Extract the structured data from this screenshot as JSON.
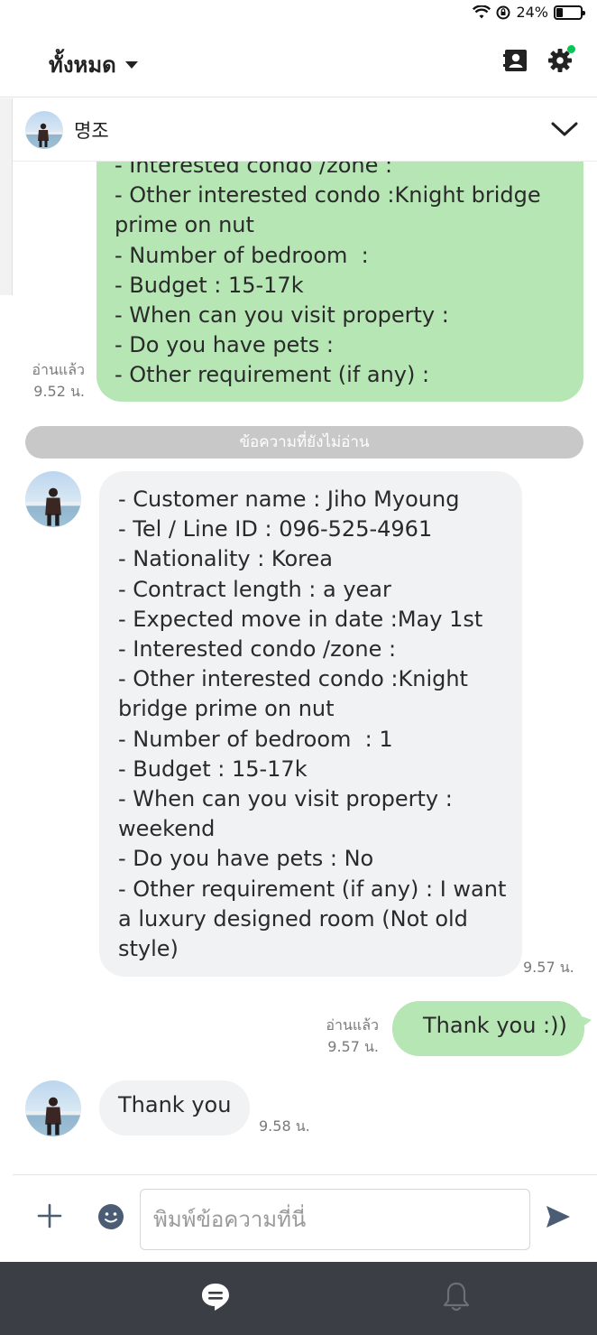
{
  "status_bar": {
    "battery_percent": "24%",
    "battery_level": 0.24
  },
  "header": {
    "title": "ทั้งหมด"
  },
  "chat": {
    "name": "명조"
  },
  "messages": {
    "m1": {
      "lines": [
        "- Interested condo /zone :",
        "- Other interested condo :Knight bridge",
        "prime on nut",
        "- Number of bedroom  :",
        "- Budget : 15-17k",
        "- When can you visit property :",
        "- Do you have pets :",
        "- Other requirement (if any) :"
      ],
      "read": "อ่านแล้ว",
      "time": "9.52 น."
    },
    "unread_divider": "ข้อความที่ยังไม่อ่าน",
    "m2": {
      "lines": [
        "- Customer name : Jiho Myoung",
        "- Tel / Line ID : 096-525-4961",
        "- Nationality : Korea",
        "- Contract length : a year",
        "- Expected move in date :May 1st",
        "- Interested condo /zone :",
        "- Other interested condo :Knight",
        "bridge prime on nut",
        "- Number of bedroom  : 1",
        "- Budget : 15-17k",
        "- When can you visit property :",
        "weekend",
        "- Do you have pets : No",
        "- Other requirement (if any) : I want",
        "a luxury designed room (Not old",
        "style)"
      ],
      "time": "9.57 น."
    },
    "m3": {
      "text": "Thank you :))",
      "read": "อ่านแล้ว",
      "time": "9.57 น."
    },
    "m4": {
      "text": "Thank you",
      "time": "9.58 น."
    }
  },
  "input": {
    "placeholder": "พิมพ์ข้อความที่นี่"
  },
  "icons": {
    "accent_green": "#06c755",
    "bubble_out": "#b5e6b4",
    "bubble_in": "#f1f2f4",
    "nav_bg": "#3b3e44"
  }
}
